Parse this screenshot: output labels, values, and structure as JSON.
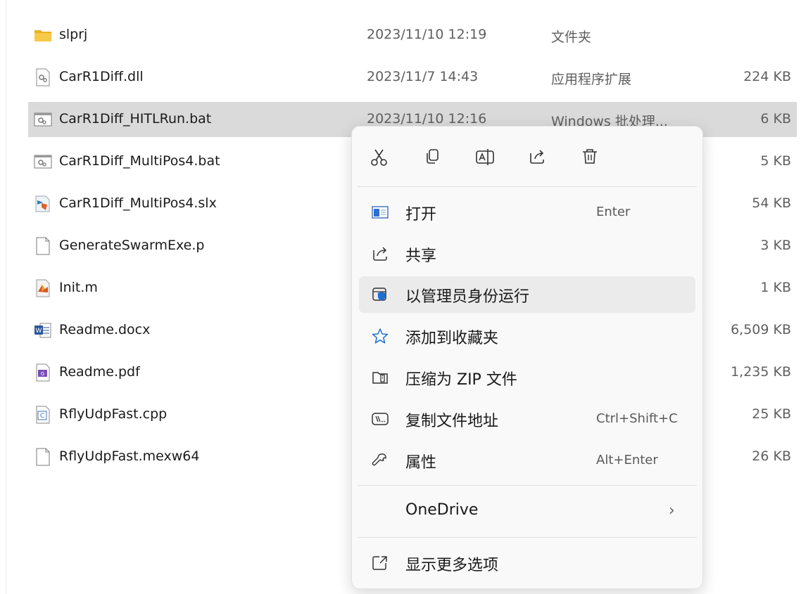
{
  "files": [
    {
      "name": "slprj",
      "date": "2023/11/10 12:19",
      "type": "文件夹",
      "size": "",
      "icon": "folder-icon"
    },
    {
      "name": "CarR1Diff.dll",
      "date": "2023/11/7 14:43",
      "type": "应用程序扩展",
      "size": "224 KB",
      "icon": "dll-file-icon"
    },
    {
      "name": "CarR1Diff_HITLRun.bat",
      "date": "2023/11/10 12:16",
      "type": "Windows 批处理...",
      "size": "6 KB",
      "icon": "bat-file-icon"
    },
    {
      "name": "CarR1Diff_MultiPos4.bat",
      "date": "",
      "type": "",
      "size": "5 KB",
      "icon": "bat-file-icon"
    },
    {
      "name": "CarR1Diff_MultiPos4.slx",
      "date": "",
      "type": "",
      "size": "54 KB",
      "icon": "simulink-file-icon"
    },
    {
      "name": "GenerateSwarmExe.p",
      "date": "",
      "type": "",
      "size": "3 KB",
      "icon": "blank-file-icon"
    },
    {
      "name": "Init.m",
      "date": "",
      "type": "",
      "size": "1 KB",
      "icon": "matlab-file-icon"
    },
    {
      "name": "Readme.docx",
      "date": "",
      "type": "",
      "size": "6,509 KB",
      "icon": "word-file-icon"
    },
    {
      "name": "Readme.pdf",
      "date": "",
      "type": "",
      "size": "1,235 KB",
      "icon": "pdf-file-icon"
    },
    {
      "name": "RflyUdpFast.cpp",
      "date": "",
      "type": "",
      "size": "25 KB",
      "icon": "cpp-file-icon"
    },
    {
      "name": "RflyUdpFast.mexw64",
      "date": "",
      "type": "",
      "size": "26 KB",
      "icon": "blank-file-icon"
    }
  ],
  "selected_index": 2,
  "context_menu": {
    "toolbar": [
      "cut-icon",
      "copy-icon",
      "rename-icon",
      "share-icon",
      "delete-icon"
    ],
    "items": {
      "open": {
        "label": "打开",
        "shortcut": "Enter",
        "icon": "open-icon"
      },
      "share": {
        "label": "共享",
        "shortcut": "",
        "icon": "share-icon"
      },
      "runas": {
        "label": "以管理员身份运行",
        "shortcut": "",
        "icon": "shield-icon"
      },
      "favorite": {
        "label": "添加到收藏夹",
        "shortcut": "",
        "icon": "star-icon"
      },
      "zip": {
        "label": "压缩为 ZIP 文件",
        "shortcut": "",
        "icon": "zip-icon"
      },
      "copypath": {
        "label": "复制文件地址",
        "shortcut": "Ctrl+Shift+C",
        "icon": "copy-path-icon"
      },
      "properties": {
        "label": "属性",
        "shortcut": "Alt+Enter",
        "icon": "wrench-icon"
      },
      "onedrive": {
        "label": "OneDrive",
        "shortcut": "",
        "icon": "chevron-right-icon"
      },
      "more": {
        "label": "显示更多选项",
        "shortcut": "",
        "icon": "more-options-icon"
      }
    }
  },
  "colors": {
    "accent": "#005fb8",
    "selection": "#dadada",
    "menu_bg": "#f9f9f9",
    "hover": "#ebebeb"
  }
}
